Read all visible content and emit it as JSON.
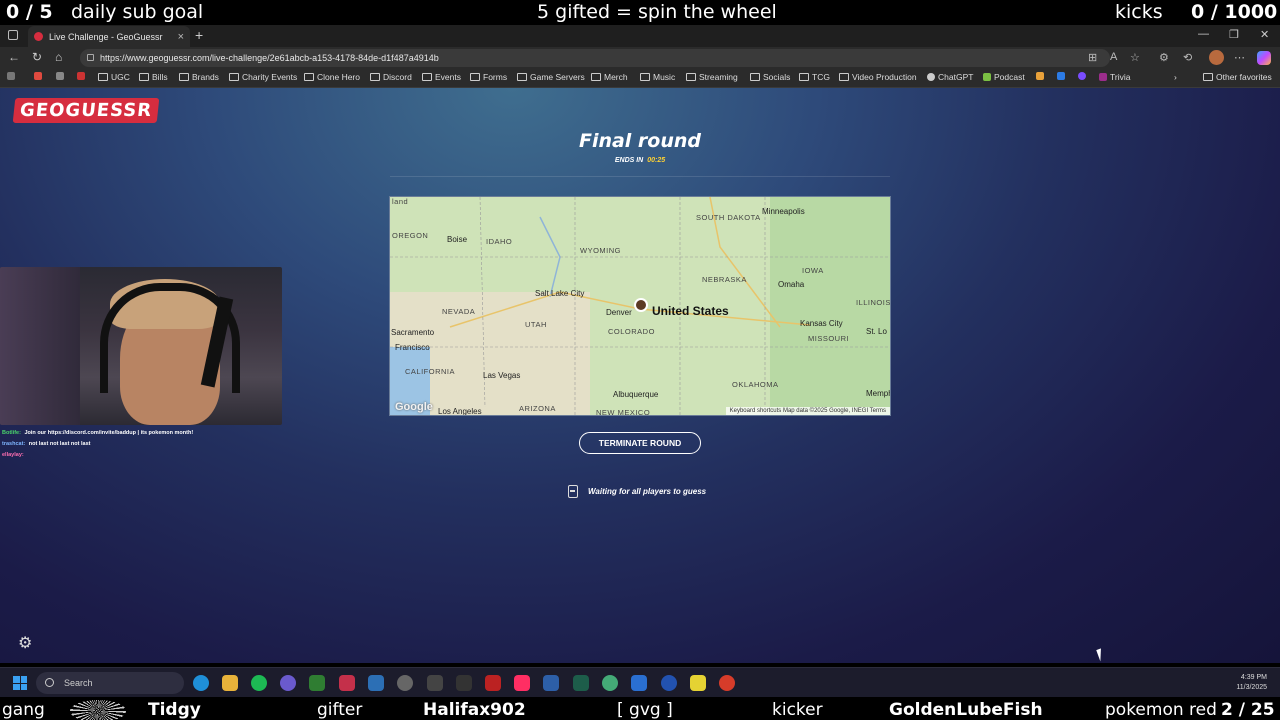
{
  "overlay_top": {
    "daily_count": "0 / 5",
    "daily_label": "daily sub goal",
    "center_text": "5 gifted = spin the wheel",
    "kicks_label": "kicks",
    "kicks_count": "0 / 1000"
  },
  "browser": {
    "tab_title": "Live Challenge - GeoGuessr",
    "url": "https://www.geoguessr.com/live-challenge/2e61abcb-a153-4178-84de-d1f487a4914b",
    "bookmarks": [
      "UGC",
      "Bills",
      "Brands",
      "Charity Events",
      "Clone Hero",
      "Discord",
      "Events",
      "Forms",
      "Game Servers",
      "Merch",
      "Music",
      "Streaming",
      "Socials",
      "TCG",
      "Video Production",
      "ChatGPT",
      "Podcast",
      "Trivia"
    ],
    "other_favorites": "Other favorites"
  },
  "game": {
    "logo": "GEOGUESSR",
    "round_title": "Final round",
    "ends_label": "ENDS IN",
    "timer": "00:25",
    "terminate_label": "TERMINATE ROUND",
    "waiting_text": "Waiting for all players to guess"
  },
  "map": {
    "country": "United States",
    "labels": {
      "land": "land",
      "south_dakota": "SOUTH DAKOTA",
      "minneapolis": "Minneapolis",
      "oregon": "OREGON",
      "boise": "Boise",
      "idaho": "IDAHO",
      "wyoming": "WYOMING",
      "iowa": "IOWA",
      "nebraska": "NEBRASKA",
      "omaha": "Omaha",
      "illinois": "ILLINOIS",
      "salt_lake": "Salt Lake City",
      "nevada": "NEVADA",
      "utah": "UTAH",
      "denver": "Denver",
      "sacramento": "Sacramento",
      "colorado": "COLORADO",
      "kansas_city": "Kansas City",
      "st_louis": "St. Lo",
      "missouri": "MISSOURI",
      "san_francisco": "Francisco",
      "california": "CALIFORNIA",
      "las_vegas": "Las Vegas",
      "albuquerque": "Albuquerque",
      "oklahoma": "OKLAHOMA",
      "memphis": "Memph",
      "los_angeles": "Los Angeles",
      "arizona": "ARIZONA",
      "new_mexico": "NEW MEXICO"
    },
    "google": "Google",
    "footer": "Keyboard shortcuts   Map data ©2025 Google, INEGI   Terms"
  },
  "chat": [
    {
      "user": "Botlife:",
      "text": "Join our https://discord.com/invite/baddup | its pokemon month!",
      "color": "#4ad36b"
    },
    {
      "user": "trashcat:",
      "text": "not last not last not last",
      "color": "#7fb6ff"
    },
    {
      "user": "ellaylay:",
      "text": "",
      "color": "#ff6fb1"
    }
  ],
  "taskbar": {
    "search_label": "Search",
    "time": "4:39 PM",
    "date": "11/3/2025"
  },
  "overlay_bottom": {
    "gang": "gang",
    "tidgy": "Tidgy",
    "gifter": "gifter",
    "halifax": "Halifax902",
    "gvg": "[ gvg ]",
    "kicker": "kicker",
    "goldenlube": "GoldenLubeFish",
    "pokemon_label": "pokemon red",
    "pokemon_count": "2 / 25"
  },
  "colors": {
    "geoguessr_red": "#d62d3f",
    "timer_yellow": "#ffd233",
    "page_bg_top": "#3f6e8f",
    "page_bg_bottom": "#15143a"
  }
}
